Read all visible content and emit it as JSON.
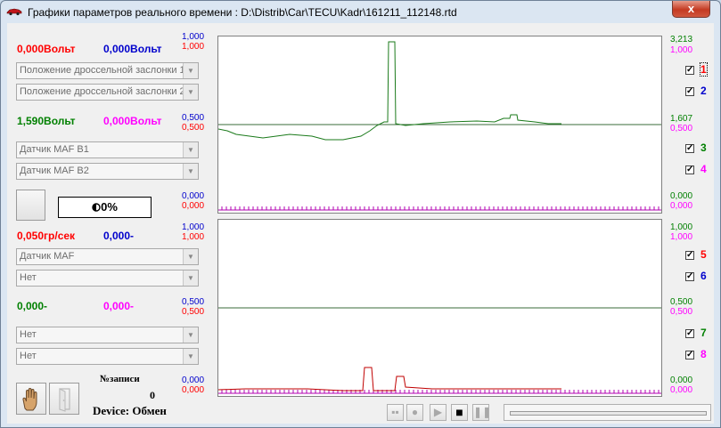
{
  "window": {
    "title": "Графики параметров реального времени : D:\\Distrib\\Car\\TECU\\Kadr\\161211_112148.rtd",
    "close_label": "x"
  },
  "channels": [
    {
      "id": 1,
      "value": "0,000",
      "unit": "Вольт",
      "color": "#ff0000",
      "param": "Положение дроссельной заслонки 1",
      "checked": true,
      "axis_max": "1,000",
      "axis_mid": "0,500",
      "axis_min": "0,000"
    },
    {
      "id": 2,
      "value": "0,000",
      "unit": "Вольт",
      "color": "#0000cc",
      "param": "Положение дроссельной заслонки 2",
      "checked": true,
      "axis_max": "1,000",
      "axis_mid": "0,500",
      "axis_min": "0,000"
    },
    {
      "id": 3,
      "value": "1,590",
      "unit": "Вольт",
      "color": "#008000",
      "param": "Датчик MAF B1",
      "checked": true,
      "axis_max": "3,213",
      "axis_mid": "1,607",
      "axis_min": "0,000"
    },
    {
      "id": 4,
      "value": "0,000",
      "unit": "Вольт",
      "color": "#ff00ff",
      "param": "Датчик MAF B2",
      "checked": true,
      "axis_max": "1,000",
      "axis_mid": "0,500",
      "axis_min": "0,000"
    },
    {
      "id": 5,
      "value": "0,050",
      "unit": "гр/сек",
      "color": "#ff0000",
      "param": "Датчик MAF",
      "checked": true,
      "axis_max": "1,000",
      "axis_mid": "0,500",
      "axis_min": "0,000"
    },
    {
      "id": 6,
      "value": "0,000",
      "unit": "-",
      "color": "#0000cc",
      "param": "Нет",
      "checked": true,
      "axis_max": "1,000",
      "axis_mid": "0,500",
      "axis_min": "0,000"
    },
    {
      "id": 7,
      "value": "0,000",
      "unit": "-",
      "color": "#008000",
      "param": "Нет",
      "checked": true,
      "axis_max": "1,000",
      "axis_mid": "0,500",
      "axis_min": "0,000"
    },
    {
      "id": 8,
      "value": "0,000",
      "unit": "-",
      "color": "#ff00ff",
      "param": "Нет",
      "checked": true,
      "axis_max": "1,000",
      "axis_mid": "0,500",
      "axis_min": "0,000"
    }
  ],
  "percent": "0%",
  "record": {
    "label": "№записи",
    "value": "0"
  },
  "device": "Device: Обмен",
  "icons": {
    "app": "car-icon",
    "hand": "hand-icon",
    "exit": "exit-door-icon",
    "rewind": "rewind-icon",
    "record": "record-icon",
    "play": "play-icon",
    "stop": "stop-icon",
    "pause": "pause-icon"
  }
}
